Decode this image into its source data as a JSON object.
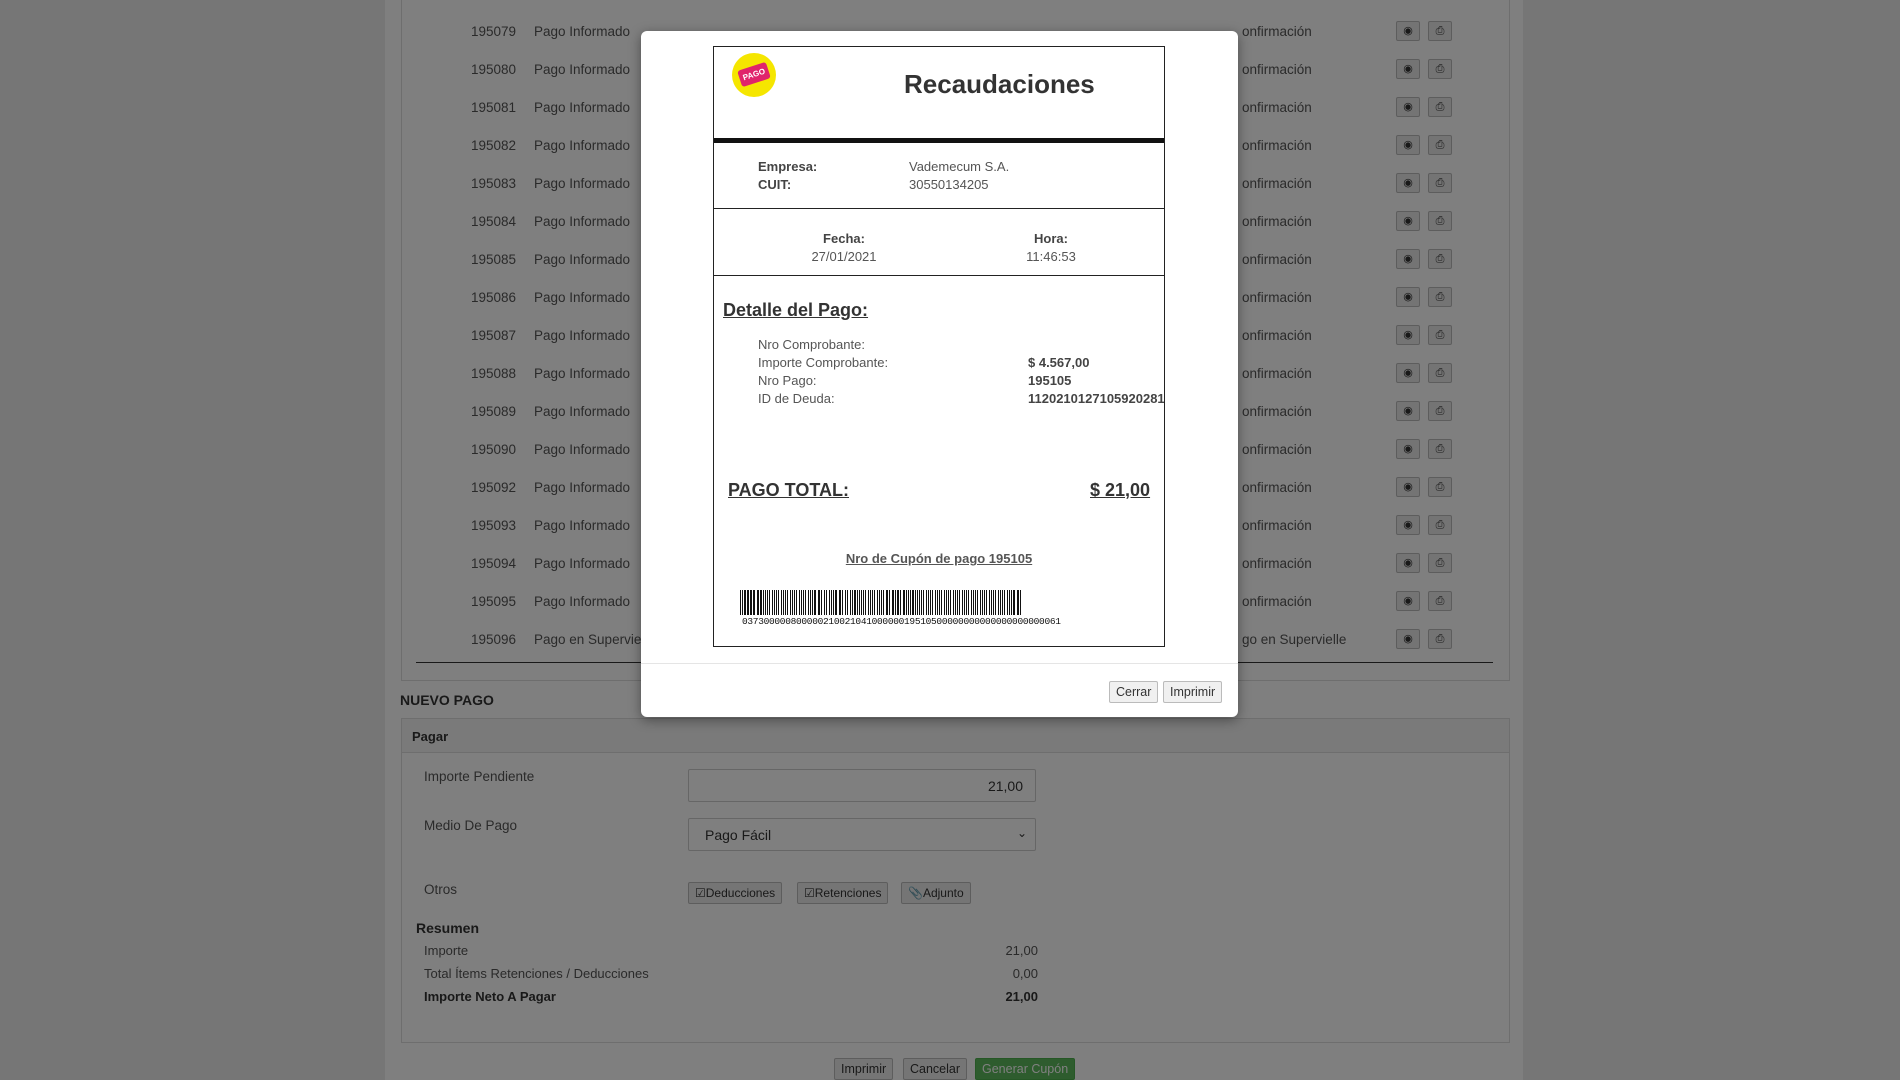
{
  "list": {
    "rows": [
      {
        "id": "195079",
        "tipo": "Pago Informado",
        "estado": "onfirmación"
      },
      {
        "id": "195080",
        "tipo": "Pago Informado",
        "estado": "onfirmación"
      },
      {
        "id": "195081",
        "tipo": "Pago Informado",
        "estado": "onfirmación"
      },
      {
        "id": "195082",
        "tipo": "Pago Informado",
        "estado": "onfirmación"
      },
      {
        "id": "195083",
        "tipo": "Pago Informado",
        "estado": "onfirmación"
      },
      {
        "id": "195084",
        "tipo": "Pago Informado",
        "estado": "onfirmación"
      },
      {
        "id": "195085",
        "tipo": "Pago Informado",
        "estado": "onfirmación"
      },
      {
        "id": "195086",
        "tipo": "Pago Informado",
        "estado": "onfirmación"
      },
      {
        "id": "195087",
        "tipo": "Pago Informado",
        "estado": "onfirmación"
      },
      {
        "id": "195088",
        "tipo": "Pago Informado",
        "estado": "onfirmación"
      },
      {
        "id": "195089",
        "tipo": "Pago Informado",
        "estado": "onfirmación"
      },
      {
        "id": "195090",
        "tipo": "Pago Informado",
        "estado": "onfirmación"
      },
      {
        "id": "195092",
        "tipo": "Pago Informado",
        "estado": "onfirmación"
      },
      {
        "id": "195093",
        "tipo": "Pago Informado",
        "estado": "onfirmación"
      },
      {
        "id": "195094",
        "tipo": "Pago Informado",
        "estado": "onfirmación"
      },
      {
        "id": "195095",
        "tipo": "Pago Informado",
        "estado": "onfirmación"
      },
      {
        "id": "195096",
        "tipo": "Pago en Supervielle",
        "estado": "go en Supervielle"
      }
    ]
  },
  "nuevo_pago": {
    "section_title": "NUEVO PAGO",
    "panel_title": "Pagar",
    "importe_pendiente_label": "Importe Pendiente",
    "importe_pendiente_value": "21,00",
    "medio_label": "Medio De Pago",
    "medio_value": "Pago Fácil",
    "otros_label": "Otros",
    "btn_deducciones": "Deducciones",
    "btn_retenciones": "Retenciones",
    "btn_adjunto": "Adjunto",
    "resumen_title": "Resumen",
    "importe_label": "Importe",
    "importe_value": "21,00",
    "total_items_label": "Total Ítems Retenciones / Deducciones",
    "total_items_value": "0,00",
    "neto_label": "Importe Neto A Pagar",
    "neto_value": "21,00"
  },
  "bottom_buttons": {
    "imprimir": "Imprimir",
    "cancelar": "Cancelar",
    "generar": "Generar Cupón"
  },
  "modal": {
    "receipt": {
      "logo_text": "PAGO",
      "title": "Recaudaciones",
      "empresa_label": "Empresa:",
      "empresa_value": "Vademecum S.A.",
      "cuit_label": "CUIT:",
      "cuit_value": "30550134205",
      "fecha_label": "Fecha:",
      "fecha_value": "27/01/2021",
      "hora_label": "Hora:",
      "hora_value": "11:46:53",
      "detalle_title": "Detalle del Pago:",
      "nro_comprobante_label": "Nro Comprobante:",
      "nro_comprobante_value": "",
      "importe_comprobante_label": "Importe Comprobante:",
      "importe_comprobante_value": "$ 4.567,00",
      "nro_pago_label": "Nro Pago:",
      "nro_pago_value": "195105",
      "id_deuda_label": "ID de Deuda:",
      "id_deuda_value": "1120210127105920281",
      "total_label": "PAGO TOTAL:",
      "total_value": "$ 21,00",
      "cupon_text": "Nro de Cupón de pago 195105",
      "barcode_number": "03730000080000021002104100000019510500000000000000000000061"
    },
    "btn_cerrar": "Cerrar",
    "btn_imprimir": "Imprimir"
  }
}
